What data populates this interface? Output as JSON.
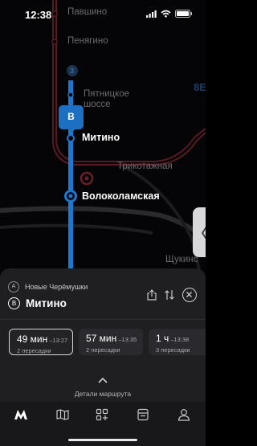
{
  "status_bar": {
    "time": "12:38"
  },
  "map": {
    "stations": [
      {
        "name": "Павшино"
      },
      {
        "name": "Пенягино"
      },
      {
        "name": "Пятницкое\nшоссе"
      },
      {
        "name": "Митино"
      },
      {
        "name": "Трикотажная"
      },
      {
        "name": "Волоколамская"
      },
      {
        "name": "Щукинс"
      }
    ],
    "line_badge": "3",
    "edge_text": "8Е",
    "pin_label": "B",
    "side_handle": "〈",
    "colors": {
      "blue_line": "#1a78d0",
      "red_line": "#5a1a22",
      "pin": "#1c6fc1"
    }
  },
  "route": {
    "from_badge": "A",
    "from": "Новые Черёмушки",
    "to_badge": "B",
    "to": "Митино",
    "options": [
      {
        "duration": "49 мин",
        "arrival": "–13:27",
        "transfers": "2 пересадки",
        "selected": true
      },
      {
        "duration": "57 мин",
        "arrival": "–13:35",
        "transfers": "2 пересадки",
        "selected": false
      },
      {
        "duration": "1 ч",
        "arrival": "–13:38",
        "transfers": "3 пересадки",
        "selected": false
      }
    ],
    "details_label": "Детали маршрута"
  },
  "tabbar": {
    "tabs": [
      {
        "icon": "metro-logo-icon",
        "active": true
      },
      {
        "icon": "map-icon",
        "active": false
      },
      {
        "icon": "services-icon",
        "active": false
      },
      {
        "icon": "tickets-icon",
        "active": false
      },
      {
        "icon": "profile-icon",
        "active": false
      }
    ]
  }
}
